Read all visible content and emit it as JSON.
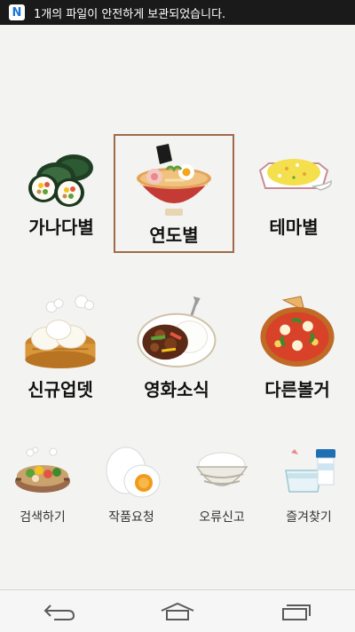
{
  "status_bar": {
    "badge": "N",
    "message": "1개의 파일이 안전하게 보관되었습니다."
  },
  "main_menu": [
    {
      "label": "가나다별",
      "icon": "kimbap-icon"
    },
    {
      "label": "연도별",
      "icon": "ramen-bowl-icon",
      "selected": true
    },
    {
      "label": "테마별",
      "icon": "fried-rice-icon"
    },
    {
      "label": "신규업뎃",
      "icon": "dumpling-steamer-icon"
    },
    {
      "label": "영화소식",
      "icon": "curry-plate-icon"
    },
    {
      "label": "다른볼거",
      "icon": "pizza-icon"
    }
  ],
  "bottom_menu": [
    {
      "label": "검색하기",
      "icon": "hotpot-icon"
    },
    {
      "label": "작품요청",
      "icon": "boiled-egg-icon"
    },
    {
      "label": "오류신고",
      "icon": "rice-bowl-icon"
    },
    {
      "label": "즐겨찾기",
      "icon": "yogurt-drink-icon"
    }
  ],
  "nav_bar": [
    "back-icon",
    "home-icon",
    "recent-apps-icon"
  ]
}
